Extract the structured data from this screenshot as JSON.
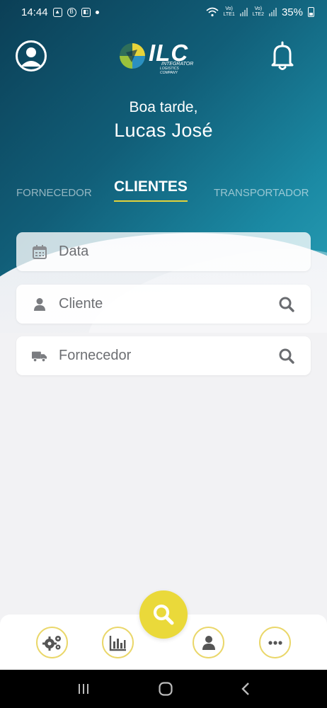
{
  "status_bar": {
    "time": "14:44",
    "net1": "Vo)\nLTE1",
    "net2": "Vo)\nLTE2",
    "battery": "35%"
  },
  "header": {
    "logo_text": "ILC",
    "logo_sub1": "INTEGRATOR",
    "logo_sub2": "LOGISTICS COMPANY"
  },
  "greeting": {
    "line1": "Boa tarde,",
    "line2": "Lucas José"
  },
  "tabs": [
    {
      "label": "FORNECEDOR"
    },
    {
      "label": "CLIENTES"
    },
    {
      "label": "TRANSPORTADOR"
    }
  ],
  "fields": {
    "date": {
      "placeholder": "Data"
    },
    "client": {
      "placeholder": "Cliente"
    },
    "supplier": {
      "placeholder": "Fornecedor"
    }
  },
  "colors": {
    "accent_yellow": "#ead93a",
    "header_teal": "#115e78"
  }
}
